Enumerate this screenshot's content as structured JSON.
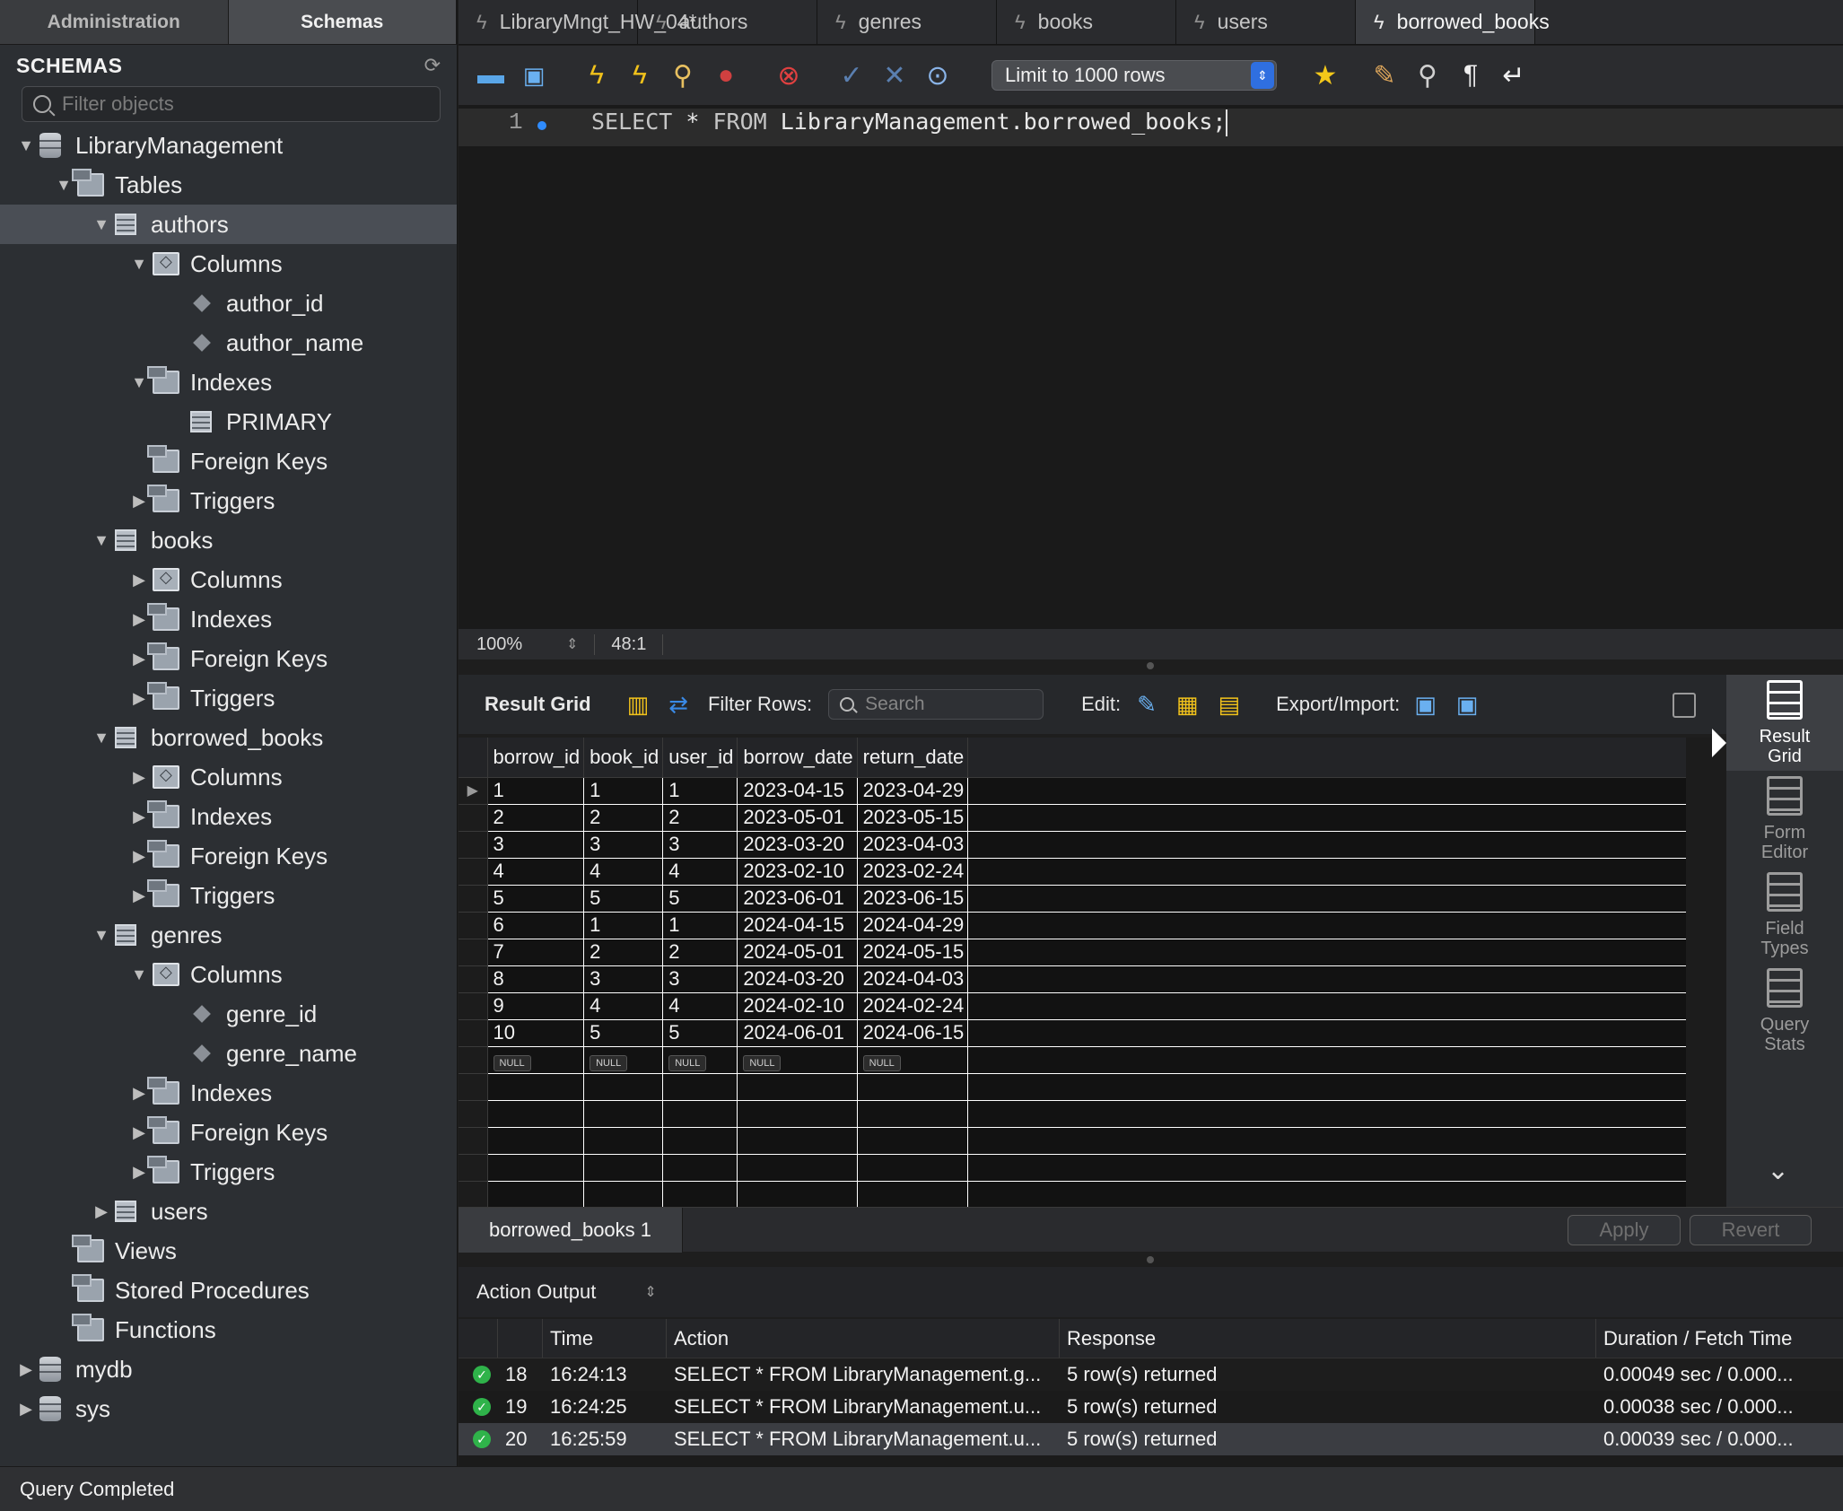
{
  "sidebar": {
    "tabs": [
      "Administration",
      "Schemas"
    ],
    "header": "SCHEMAS",
    "filter_placeholder": "Filter objects",
    "tree": [
      {
        "label": "LibraryManagement",
        "level": 0,
        "icon": "database-icon",
        "expanded": true
      },
      {
        "label": "Tables",
        "level": 1,
        "icon": "folder-icon",
        "expanded": true
      },
      {
        "label": "authors",
        "level": 2,
        "icon": "table-icon",
        "expanded": true,
        "selected": true
      },
      {
        "label": "Columns",
        "level": 3,
        "icon": "columns-icon",
        "expanded": true
      },
      {
        "label": "author_id",
        "level": 4,
        "icon": "column-icon"
      },
      {
        "label": "author_name",
        "level": 4,
        "icon": "column-icon"
      },
      {
        "label": "Indexes",
        "level": 3,
        "icon": "folder-icon",
        "expanded": true
      },
      {
        "label": "PRIMARY",
        "level": 4,
        "icon": "table-icon"
      },
      {
        "label": "Foreign Keys",
        "level": 3,
        "icon": "folder-icon"
      },
      {
        "label": "Triggers",
        "level": 3,
        "icon": "folder-icon",
        "expanded": false
      },
      {
        "label": "books",
        "level": 2,
        "icon": "table-icon",
        "expanded": true
      },
      {
        "label": "Columns",
        "level": 3,
        "icon": "columns-icon",
        "expanded": false
      },
      {
        "label": "Indexes",
        "level": 3,
        "icon": "folder-icon",
        "expanded": false
      },
      {
        "label": "Foreign Keys",
        "level": 3,
        "icon": "folder-icon",
        "expanded": false
      },
      {
        "label": "Triggers",
        "level": 3,
        "icon": "folder-icon",
        "expanded": false
      },
      {
        "label": "borrowed_books",
        "level": 2,
        "icon": "table-icon",
        "expanded": true
      },
      {
        "label": "Columns",
        "level": 3,
        "icon": "columns-icon",
        "expanded": false
      },
      {
        "label": "Indexes",
        "level": 3,
        "icon": "folder-icon",
        "expanded": false
      },
      {
        "label": "Foreign Keys",
        "level": 3,
        "icon": "folder-icon",
        "expanded": false
      },
      {
        "label": "Triggers",
        "level": 3,
        "icon": "folder-icon",
        "expanded": false
      },
      {
        "label": "genres",
        "level": 2,
        "icon": "table-icon",
        "expanded": true
      },
      {
        "label": "Columns",
        "level": 3,
        "icon": "columns-icon",
        "expanded": true
      },
      {
        "label": "genre_id",
        "level": 4,
        "icon": "column-icon"
      },
      {
        "label": "genre_name",
        "level": 4,
        "icon": "column-icon"
      },
      {
        "label": "Indexes",
        "level": 3,
        "icon": "folder-icon",
        "expanded": false
      },
      {
        "label": "Foreign Keys",
        "level": 3,
        "icon": "folder-icon",
        "expanded": false
      },
      {
        "label": "Triggers",
        "level": 3,
        "icon": "folder-icon",
        "expanded": false
      },
      {
        "label": "users",
        "level": 2,
        "icon": "table-icon",
        "expanded": false
      },
      {
        "label": "Views",
        "level": 1,
        "icon": "folder-icon"
      },
      {
        "label": "Stored Procedures",
        "level": 1,
        "icon": "folder-icon"
      },
      {
        "label": "Functions",
        "level": 1,
        "icon": "folder-icon"
      },
      {
        "label": "mydb",
        "level": 0,
        "icon": "database-icon",
        "expanded": false
      },
      {
        "label": "sys",
        "level": 0,
        "icon": "database-icon",
        "expanded": false
      }
    ]
  },
  "query_tabs": [
    {
      "label": "LibraryMngt_HW_04*",
      "active": false
    },
    {
      "label": "authors",
      "active": false
    },
    {
      "label": "genres",
      "active": false
    },
    {
      "label": "books",
      "active": false
    },
    {
      "label": "users",
      "active": false
    },
    {
      "label": "borrowed_books",
      "active": true
    }
  ],
  "toolbar": {
    "limit_select": "Limit to 1000 rows"
  },
  "editor": {
    "line_number": "1",
    "sql_keyword_1": "SELECT",
    "sql_middle": " * ",
    "sql_keyword_2": "FROM",
    "sql_rest": " LibraryManagement.borrowed_books;",
    "zoom": "100%",
    "cursor_position": "48:1"
  },
  "result_toolbar": {
    "result_grid_label": "Result Grid",
    "filter_rows_label": "Filter Rows:",
    "search_placeholder": "Search",
    "edit_label": "Edit:",
    "export_label": "Export/Import:"
  },
  "result_grid": {
    "columns": [
      "borrow_id",
      "book_id",
      "user_id",
      "borrow_date",
      "return_date"
    ],
    "rows": [
      [
        "1",
        "1",
        "1",
        "2023-04-15",
        "2023-04-29"
      ],
      [
        "2",
        "2",
        "2",
        "2023-05-01",
        "2023-05-15"
      ],
      [
        "3",
        "3",
        "3",
        "2023-03-20",
        "2023-04-03"
      ],
      [
        "4",
        "4",
        "4",
        "2023-02-10",
        "2023-02-24"
      ],
      [
        "5",
        "5",
        "5",
        "2023-06-01",
        "2023-06-15"
      ],
      [
        "6",
        "1",
        "1",
        "2024-04-15",
        "2024-04-29"
      ],
      [
        "7",
        "2",
        "2",
        "2024-05-01",
        "2024-05-15"
      ],
      [
        "8",
        "3",
        "3",
        "2024-03-20",
        "2024-04-03"
      ],
      [
        "9",
        "4",
        "4",
        "2024-02-10",
        "2024-02-24"
      ],
      [
        "10",
        "5",
        "5",
        "2024-06-01",
        "2024-06-15"
      ]
    ],
    "null_label": "NULL"
  },
  "right_panel": [
    {
      "label_1": "Result",
      "label_2": "Grid",
      "active": true
    },
    {
      "label_1": "Form",
      "label_2": "Editor",
      "active": false
    },
    {
      "label_1": "Field",
      "label_2": "Types",
      "active": false
    },
    {
      "label_1": "Query",
      "label_2": "Stats",
      "active": false
    }
  ],
  "result_tabs": {
    "tab_label": "borrowed_books 1",
    "apply_label": "Apply",
    "revert_label": "Revert"
  },
  "output": {
    "title": "Action Output",
    "columns": [
      "",
      "",
      "Time",
      "Action",
      "Response",
      "Duration / Fetch Time"
    ],
    "rows": [
      {
        "num": "18",
        "time": "16:24:13",
        "action": "SELECT * FROM LibraryManagement.g...",
        "response": "5 row(s) returned",
        "duration": "0.00049 sec / 0.000..."
      },
      {
        "num": "19",
        "time": "16:24:25",
        "action": "SELECT * FROM LibraryManagement.u...",
        "response": "5 row(s) returned",
        "duration": "0.00038 sec / 0.000..."
      },
      {
        "num": "20",
        "time": "16:25:59",
        "action": "SELECT * FROM LibraryManagement.u...",
        "response": "5 row(s) returned",
        "duration": "0.00039 sec / 0.000..."
      }
    ]
  },
  "statusbar": {
    "text": "Query Completed"
  }
}
